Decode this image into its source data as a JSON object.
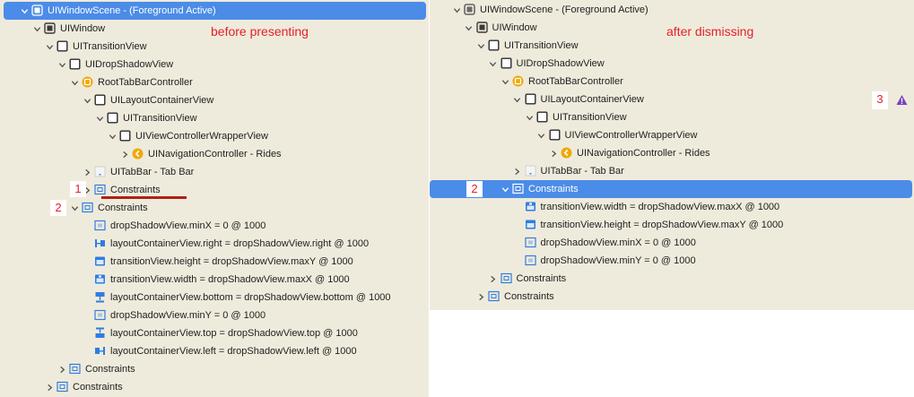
{
  "left": {
    "annotation": "before presenting",
    "marker_1": "1",
    "marker_2": "2",
    "rows": [
      {
        "label": "UIWindowScene - (Foreground Active)",
        "icon": "scene-icon",
        "chevron": "down",
        "selected": true
      },
      {
        "label": "UIWindow",
        "icon": "window-icon",
        "chevron": "down"
      },
      {
        "label": "UITransitionView",
        "icon": "view-icon",
        "chevron": "down"
      },
      {
        "label": "UIDropShadowView",
        "icon": "view-icon",
        "chevron": "down"
      },
      {
        "label": "RootTabBarController",
        "icon": "tab-controller-icon",
        "chevron": "down"
      },
      {
        "label": "UILayoutContainerView",
        "icon": "view-icon",
        "chevron": "down"
      },
      {
        "label": "UITransitionView",
        "icon": "view-icon",
        "chevron": "down"
      },
      {
        "label": "UIViewControllerWrapperView",
        "icon": "view-icon",
        "chevron": "down"
      },
      {
        "label": "UINavigationController - Rides",
        "icon": "nav-controller-icon",
        "chevron": "right"
      },
      {
        "label": "UITabBar - Tab Bar",
        "icon": "tabbar-icon",
        "chevron": "right"
      },
      {
        "label": "Constraints",
        "icon": "constraints-icon",
        "chevron": "right"
      },
      {
        "label": "Constraints",
        "icon": "constraints-icon",
        "chevron": "down"
      },
      {
        "label": "dropShadowView.minX = 0 @ 1000",
        "icon": "constraint-box-icon",
        "chevron": "none"
      },
      {
        "label": "layoutContainerView.right = dropShadowView.right @ 1000",
        "icon": "constraint-right-icon",
        "chevron": "none"
      },
      {
        "label": "transitionView.height = dropShadowView.maxY @ 1000",
        "icon": "constraint-height-icon",
        "chevron": "none"
      },
      {
        "label": "transitionView.width = dropShadowView.maxX @ 1000",
        "icon": "constraint-width-icon",
        "chevron": "none"
      },
      {
        "label": "layoutContainerView.bottom = dropShadowView.bottom @ 1000",
        "icon": "constraint-bottom-icon",
        "chevron": "none"
      },
      {
        "label": "dropShadowView.minY = 0 @ 1000",
        "icon": "constraint-box-icon",
        "chevron": "none"
      },
      {
        "label": "layoutContainerView.top = dropShadowView.top @ 1000",
        "icon": "constraint-top-icon",
        "chevron": "none"
      },
      {
        "label": "layoutContainerView.left = dropShadowView.left @ 1000",
        "icon": "constraint-left-icon",
        "chevron": "none"
      },
      {
        "label": "Constraints",
        "icon": "constraints-icon",
        "chevron": "right"
      },
      {
        "label": "Constraints",
        "icon": "constraints-icon",
        "chevron": "right"
      }
    ]
  },
  "right": {
    "annotation": "after dismissing",
    "marker_2": "2",
    "marker_3": "3",
    "rows": [
      {
        "label": "UIWindowScene - (Foreground Active)",
        "icon": "scene-icon",
        "chevron": "down"
      },
      {
        "label": "UIWindow",
        "icon": "window-icon",
        "chevron": "down"
      },
      {
        "label": "UITransitionView",
        "icon": "view-icon",
        "chevron": "down"
      },
      {
        "label": "UIDropShadowView",
        "icon": "view-icon",
        "chevron": "down"
      },
      {
        "label": "RootTabBarController",
        "icon": "tab-controller-icon",
        "chevron": "down"
      },
      {
        "label": "UILayoutContainerView",
        "icon": "view-icon",
        "chevron": "down"
      },
      {
        "label": "UITransitionView",
        "icon": "view-icon",
        "chevron": "down"
      },
      {
        "label": "UIViewControllerWrapperView",
        "icon": "view-icon",
        "chevron": "down"
      },
      {
        "label": "UINavigationController - Rides",
        "icon": "nav-controller-icon",
        "chevron": "right"
      },
      {
        "label": "UITabBar - Tab Bar",
        "icon": "tabbar-icon",
        "chevron": "right"
      },
      {
        "label": "Constraints",
        "icon": "constraints-icon",
        "chevron": "down",
        "selected": true
      },
      {
        "label": "transitionView.width = dropShadowView.maxX @ 1000",
        "icon": "constraint-width-icon",
        "chevron": "none"
      },
      {
        "label": "transitionView.height = dropShadowView.maxY @ 1000",
        "icon": "constraint-height-icon",
        "chevron": "none"
      },
      {
        "label": "dropShadowView.minX = 0 @ 1000",
        "icon": "constraint-box-icon",
        "chevron": "none"
      },
      {
        "label": "dropShadowView.minY = 0 @ 1000",
        "icon": "constraint-box-icon",
        "chevron": "none"
      },
      {
        "label": "Constraints",
        "icon": "constraints-icon",
        "chevron": "right"
      },
      {
        "label": "Constraints",
        "icon": "constraints-icon",
        "chevron": "right"
      }
    ],
    "warning_icon": "warning-triangle-icon"
  },
  "colors": {
    "panel_background": "#efebdc",
    "selection": "#4b8ce8",
    "accent_blue": "#2f7de1",
    "controller_yellow": "#f0a70a",
    "annotation_red": "#e5202a",
    "underline_red": "#b21f13",
    "warning_purple": "#7b3fbf"
  }
}
